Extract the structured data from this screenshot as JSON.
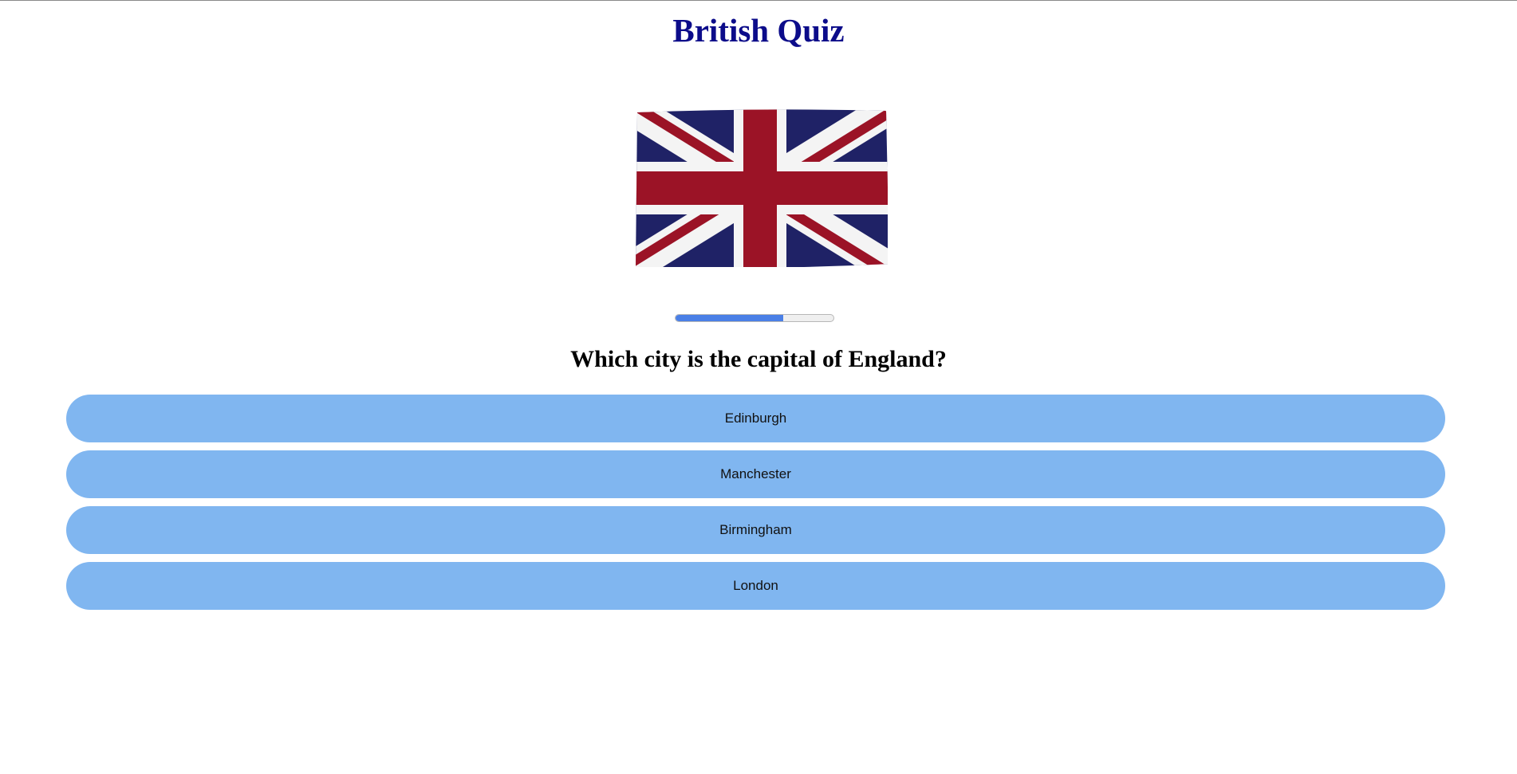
{
  "colors": {
    "title": "#0c0c8a",
    "progress_fill": "#4a7fe6",
    "answer_bg": "#80b6f0"
  },
  "header": {
    "title": "British Quiz"
  },
  "flag": {
    "icon": "union-jack-flag"
  },
  "progress": {
    "fraction": 0.68
  },
  "quiz": {
    "question": "Which city is the capital of England?",
    "answers": [
      {
        "label": "Edinburgh"
      },
      {
        "label": "Manchester"
      },
      {
        "label": "Birmingham"
      },
      {
        "label": "London"
      }
    ]
  }
}
